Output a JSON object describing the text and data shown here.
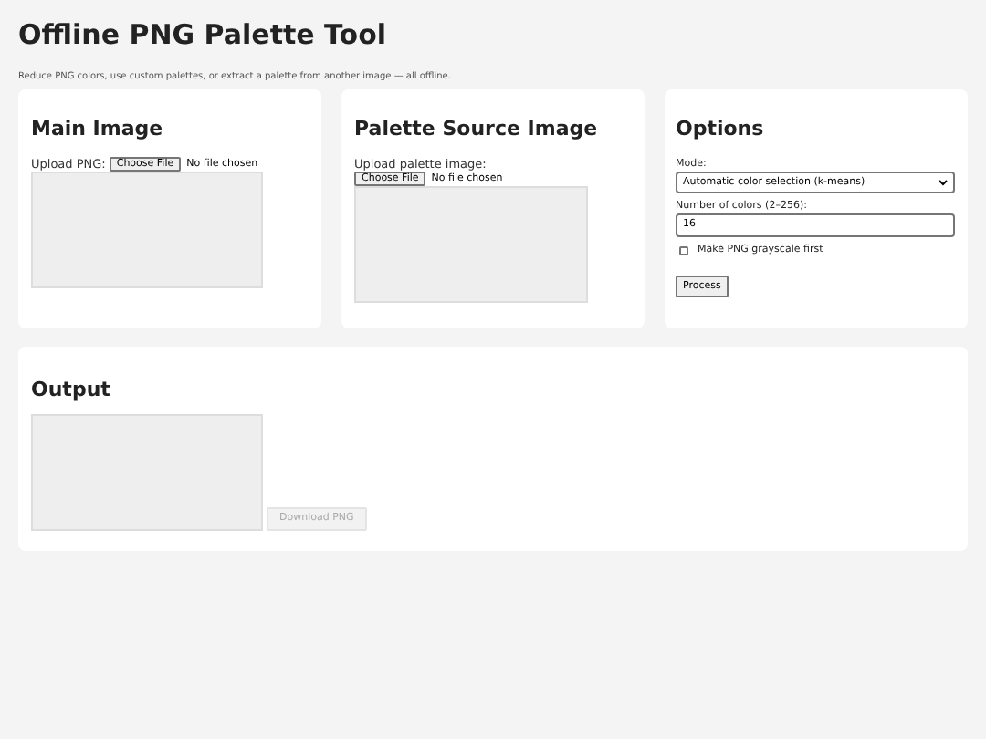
{
  "title": "Offline PNG Palette Tool",
  "subtitle": "Reduce PNG colors, use custom palettes, or extract a palette from another image — all offline.",
  "main_image": {
    "heading": "Main Image",
    "upload_label": "Upload PNG:",
    "file_button": "Choose File",
    "file_status": "No file chosen"
  },
  "palette_source": {
    "heading": "Palette Source Image",
    "upload_label": "Upload palette image:",
    "file_button": "Choose File",
    "file_status": "No file chosen"
  },
  "options": {
    "heading": "Options",
    "mode_label": "Mode:",
    "mode_value": "Automatic color selection (k-means)",
    "colors_label": "Number of colors (2–256):",
    "colors_value": "16",
    "grayscale": {
      "label": "Make PNG grayscale first",
      "checked": false
    },
    "process_button": "Process"
  },
  "output": {
    "heading": "Output",
    "download_button": {
      "label": "Download PNG",
      "disabled": true
    }
  }
}
